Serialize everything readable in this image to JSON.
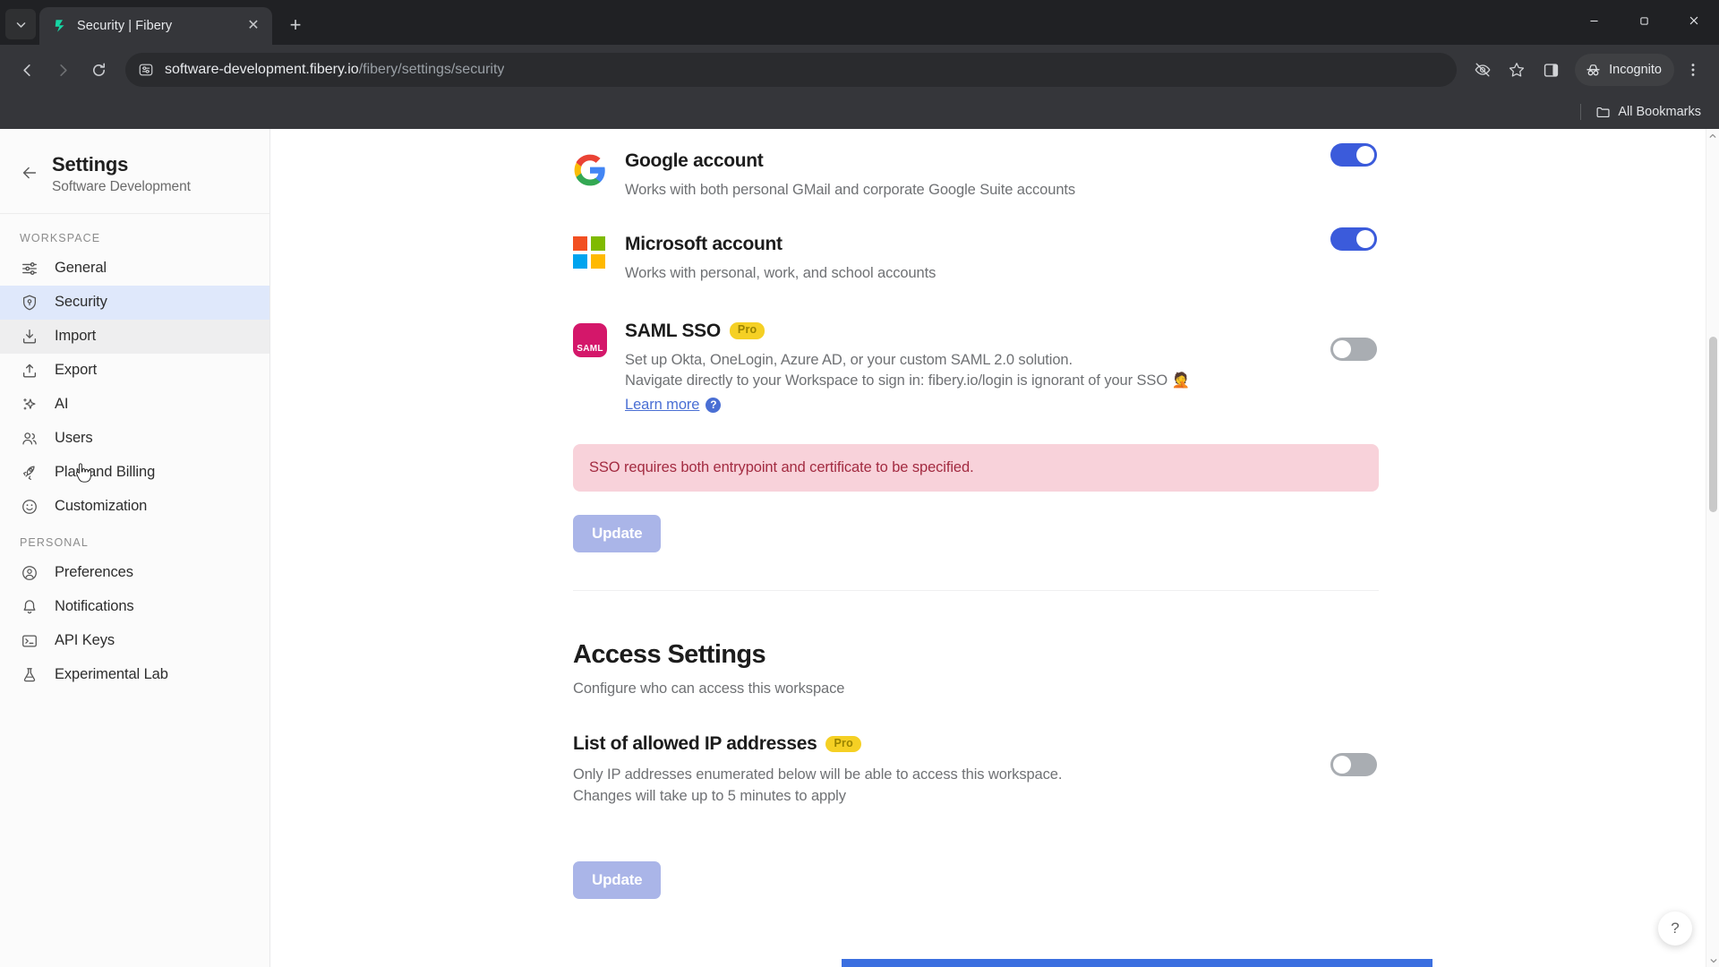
{
  "browser": {
    "tab": {
      "title": "Security | Fibery",
      "favicon": "fibery-logo-icon",
      "close_label": "✕"
    },
    "new_tab_label": "+",
    "tabstrip_chevron": "chevron-down-icon",
    "window_controls": {
      "minimize": "–",
      "maximize": "❐",
      "close": "✕"
    },
    "nav": {
      "back": "←",
      "forward": "→",
      "reload": "⟳"
    },
    "omnibox": {
      "site_info_icon": "site-settings-icon",
      "url_host": "software-development.fibery.io",
      "url_path": "/fibery/settings/security",
      "url_full": "software-development.fibery.io/fibery/settings/security"
    },
    "toolbar_icons": [
      "eye-off-icon",
      "bookmark-star-icon",
      "side-panel-icon"
    ],
    "incognito_label": "Incognito",
    "menu_icon": "kebab-menu-icon",
    "bookmarks_bar": {
      "all_bookmarks_label": "All Bookmarks",
      "folder_icon": "folder-icon"
    }
  },
  "sidebar": {
    "back_icon": "arrow-left-icon",
    "title": "Settings",
    "subtitle": "Software Development",
    "groups": [
      {
        "label": "WORKSPACE",
        "items": [
          {
            "label": "General",
            "icon": "sliders-icon",
            "state": "normal"
          },
          {
            "label": "Security",
            "icon": "shield-icon",
            "state": "active"
          },
          {
            "label": "Import",
            "icon": "download-icon",
            "state": "hover"
          },
          {
            "label": "Export",
            "icon": "upload-icon",
            "state": "normal"
          },
          {
            "label": "AI",
            "icon": "sparkle-icon",
            "state": "normal"
          },
          {
            "label": "Users",
            "icon": "users-icon",
            "state": "normal"
          },
          {
            "label": "Plan and Billing",
            "icon": "rocket-icon",
            "state": "normal"
          },
          {
            "label": "Customization",
            "icon": "smiley-icon",
            "state": "normal"
          }
        ]
      },
      {
        "label": "PERSONAL",
        "items": [
          {
            "label": "Preferences",
            "icon": "user-circle-icon",
            "state": "normal"
          },
          {
            "label": "Notifications",
            "icon": "bell-icon",
            "state": "normal"
          },
          {
            "label": "API Keys",
            "icon": "terminal-icon",
            "state": "normal"
          },
          {
            "label": "Experimental Lab",
            "icon": "flask-icon",
            "state": "normal"
          }
        ]
      }
    ]
  },
  "main": {
    "auth_methods": [
      {
        "id": "google",
        "icon": "google-logo-icon",
        "title": "Google account",
        "description": "Works with both personal GMail and corporate Google Suite accounts",
        "toggle": "on"
      },
      {
        "id": "microsoft",
        "icon": "microsoft-logo-icon",
        "title": "Microsoft account",
        "description": "Works with personal, work, and school accounts",
        "toggle": "on"
      },
      {
        "id": "saml",
        "icon": "saml-logo-icon",
        "icon_text": "SAML",
        "title": "SAML SSO",
        "badge": "Pro",
        "description_line1": "Set up Okta, OneLogin, Azure AD, or your custom SAML 2.0 solution.",
        "description_line2": "Navigate directly to your Workspace to sign in: fibery.io/login is ignorant of your SSO 🤦",
        "learn_more": "Learn more",
        "toggle": "off"
      }
    ],
    "sso_alert": "SSO requires both entrypoint and certificate to be specified.",
    "sso_update_button": "Update",
    "access_settings": {
      "title": "Access Settings",
      "subtitle": "Configure who can access this workspace",
      "ip_allowlist": {
        "title": "List of allowed IP addresses",
        "badge": "Pro",
        "description_line1": "Only IP addresses enumerated below will be able to access this workspace.",
        "description_line2": "Changes will take up to 5 minutes to apply",
        "toggle": "off"
      },
      "update_button": "Update"
    },
    "help_button": "?"
  },
  "colors": {
    "accent_blue": "#3b5bdb",
    "sidebar_active": "#dfe8fb",
    "alert_bg": "#f8d2da",
    "alert_text": "#a32b41",
    "pro_badge_bg": "#f5d024",
    "button_disabled": "#aab5e8",
    "scrollbar_blue": "#3b6fe0"
  }
}
